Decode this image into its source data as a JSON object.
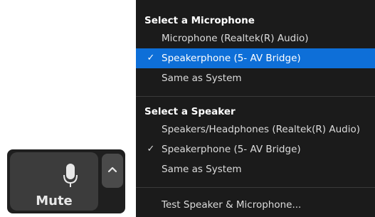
{
  "mute_control": {
    "label": "Mute",
    "mic_icon": "microphone-icon",
    "arrow_icon": "chevron-up-icon"
  },
  "menu": {
    "microphone_section": {
      "heading": "Select a Microphone",
      "items": [
        {
          "label": "Microphone (Realtek(R) Audio)",
          "checked": false,
          "highlighted": false
        },
        {
          "label": "Speakerphone (5- AV Bridge)",
          "checked": true,
          "highlighted": true
        },
        {
          "label": "Same as System",
          "checked": false,
          "highlighted": false
        }
      ]
    },
    "speaker_section": {
      "heading": "Select a Speaker",
      "items": [
        {
          "label": "Speakers/Headphones (Realtek(R) Audio)",
          "checked": false,
          "highlighted": false
        },
        {
          "label": "Speakerphone (5- AV Bridge)",
          "checked": true,
          "highlighted": false
        },
        {
          "label": "Same as System",
          "checked": false,
          "highlighted": false
        }
      ]
    },
    "actions": [
      {
        "label": "Test Speaker & Microphone..."
      }
    ],
    "check_glyph": "✓",
    "colors": {
      "menu_background": "#1b1b1b",
      "highlight": "#0e6fd8",
      "text": "#dcdcdc"
    }
  }
}
